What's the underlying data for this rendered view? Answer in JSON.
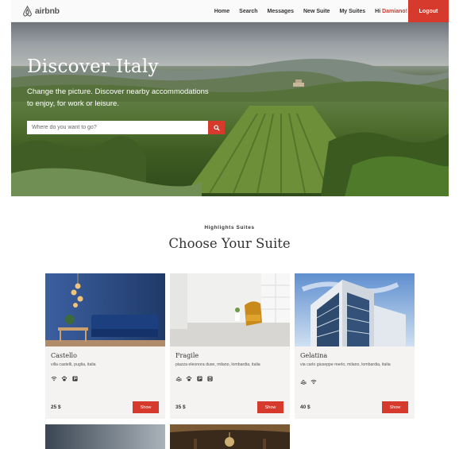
{
  "nav": {
    "logo_text": "airbnb",
    "links": [
      "Home",
      "Search",
      "Messages",
      "New Suite",
      "My Suites"
    ],
    "greeting": "Hi",
    "user": "Damiano!",
    "logout": "Logout"
  },
  "hero": {
    "title": "Discover Italy",
    "subtitle": "Change the picture. Discover nearby accommodations to enjoy, for work or leisure.",
    "search_placeholder": "Where do you want to go?"
  },
  "section": {
    "kicker": "Highlights Suites",
    "title": "Choose Your Suite"
  },
  "cards": [
    {
      "name": "Castello",
      "address": "villa castelli, puglia, italia",
      "price": "25 $",
      "button": "Show",
      "amenities": [
        "wifi-icon",
        "pet-icon",
        "parking-icon"
      ]
    },
    {
      "name": "Fragile",
      "address": "piazza eleonora duse, milano, lombardia, italia",
      "price": "35 $",
      "button": "Show",
      "amenities": [
        "pool-icon",
        "pet-icon",
        "parking-icon",
        "kitchen-icon"
      ]
    },
    {
      "name": "Gelatina",
      "address": "via carlo giuseppe merlo, milano, lombardia, italia",
      "price": "40 $",
      "button": "Show",
      "amenities": [
        "pool-icon",
        "wifi-icon"
      ]
    }
  ],
  "colors": {
    "accent": "#d63a2c",
    "card_bg": "#f4f3f2",
    "text": "#333333"
  }
}
